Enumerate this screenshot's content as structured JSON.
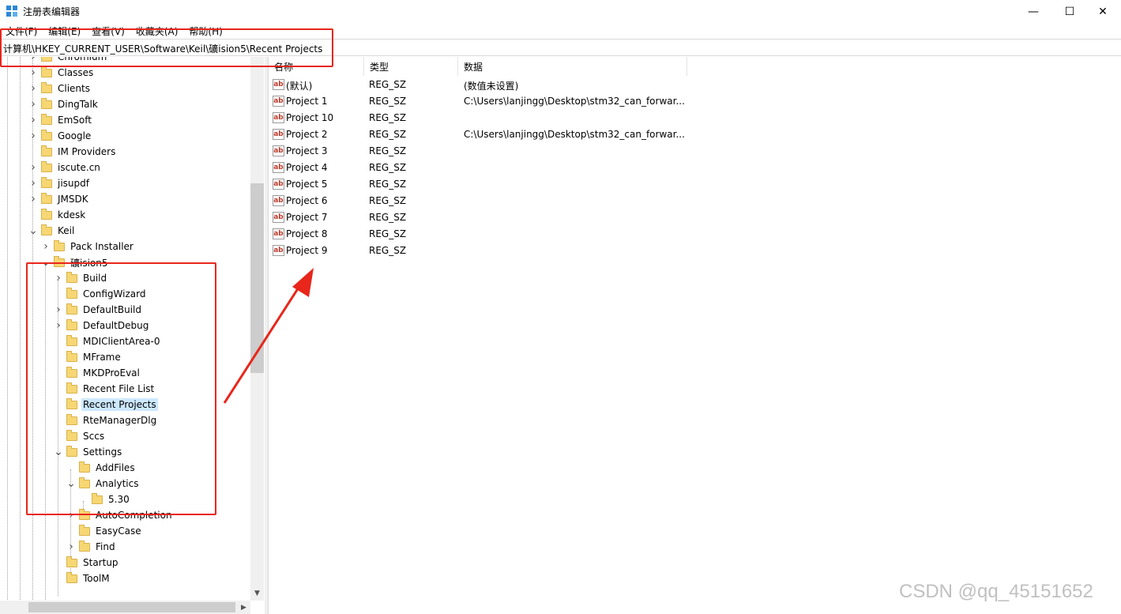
{
  "window": {
    "title": "注册表编辑器",
    "controls": {
      "minimize": "—",
      "maximize": "☐",
      "close": "✕"
    }
  },
  "menu": [
    {
      "label": "文件(F)"
    },
    {
      "label": "编辑(E)"
    },
    {
      "label": "查看(V)"
    },
    {
      "label": "收藏夹(A)"
    },
    {
      "label": "帮助(H)"
    }
  ],
  "address": "计算机\\HKEY_CURRENT_USER\\Software\\Keil\\礦ision5\\Recent Projects",
  "tree": {
    "nodes": [
      {
        "label": "Chromium",
        "expander": "collapsed"
      },
      {
        "label": "Classes",
        "expander": "collapsed"
      },
      {
        "label": "Clients",
        "expander": "collapsed"
      },
      {
        "label": "DingTalk",
        "expander": "collapsed"
      },
      {
        "label": "EmSoft",
        "expander": "collapsed"
      },
      {
        "label": "Google",
        "expander": "collapsed"
      },
      {
        "label": "IM Providers",
        "expander": "none"
      },
      {
        "label": "iscute.cn",
        "expander": "collapsed"
      },
      {
        "label": "jisupdf",
        "expander": "collapsed"
      },
      {
        "label": "JMSDK",
        "expander": "collapsed"
      },
      {
        "label": "kdesk",
        "expander": "none"
      },
      {
        "label": "Keil",
        "expander": "expanded"
      },
      {
        "label": "Pack Installer",
        "expander": "collapsed"
      },
      {
        "label": "礦ision5",
        "expander": "expanded"
      },
      {
        "label": "Build",
        "expander": "collapsed"
      },
      {
        "label": "ConfigWizard",
        "expander": "none"
      },
      {
        "label": "DefaultBuild",
        "expander": "collapsed"
      },
      {
        "label": "DefaultDebug",
        "expander": "collapsed"
      },
      {
        "label": "MDIClientArea-0",
        "expander": "none"
      },
      {
        "label": "MFrame",
        "expander": "none"
      },
      {
        "label": "MKDProEval",
        "expander": "none"
      },
      {
        "label": "Recent File List",
        "expander": "none"
      },
      {
        "label": "Recent Projects",
        "expander": "none",
        "selected": true
      },
      {
        "label": "RteManagerDlg",
        "expander": "none"
      },
      {
        "label": "Sccs",
        "expander": "none"
      },
      {
        "label": "Settings",
        "expander": "expanded"
      },
      {
        "label": "AddFiles",
        "expander": "none"
      },
      {
        "label": "Analytics",
        "expander": "expanded"
      },
      {
        "label": "5.30",
        "expander": "none"
      },
      {
        "label": "AutoCompletion",
        "expander": "collapsed"
      },
      {
        "label": "EasyCase",
        "expander": "none"
      },
      {
        "label": "Find",
        "expander": "collapsed"
      },
      {
        "label": "Startup",
        "expander": "none"
      },
      {
        "label": "ToolM",
        "expander": "none"
      }
    ]
  },
  "list": {
    "columns": {
      "name": "名称",
      "type": "类型",
      "data": "数据"
    },
    "icon_text": "ab",
    "rows": [
      {
        "name": "(默认)",
        "type": "REG_SZ",
        "data": "(数值未设置)"
      },
      {
        "name": "Project 1",
        "type": "REG_SZ",
        "data": "C:\\Users\\lanjingg\\Desktop\\stm32_can_forwar..."
      },
      {
        "name": "Project 10",
        "type": "REG_SZ",
        "data": ""
      },
      {
        "name": "Project 2",
        "type": "REG_SZ",
        "data": "C:\\Users\\lanjingg\\Desktop\\stm32_can_forwar..."
      },
      {
        "name": "Project 3",
        "type": "REG_SZ",
        "data": ""
      },
      {
        "name": "Project 4",
        "type": "REG_SZ",
        "data": ""
      },
      {
        "name": "Project 5",
        "type": "REG_SZ",
        "data": ""
      },
      {
        "name": "Project 6",
        "type": "REG_SZ",
        "data": ""
      },
      {
        "name": "Project 7",
        "type": "REG_SZ",
        "data": ""
      },
      {
        "name": "Project 8",
        "type": "REG_SZ",
        "data": ""
      },
      {
        "name": "Project 9",
        "type": "REG_SZ",
        "data": ""
      }
    ]
  },
  "watermark": "CSDN @qq_45151652",
  "colors": {
    "annotation_red": "#e8261b",
    "selection": "#cce8ff",
    "folder": "#f7d774"
  }
}
